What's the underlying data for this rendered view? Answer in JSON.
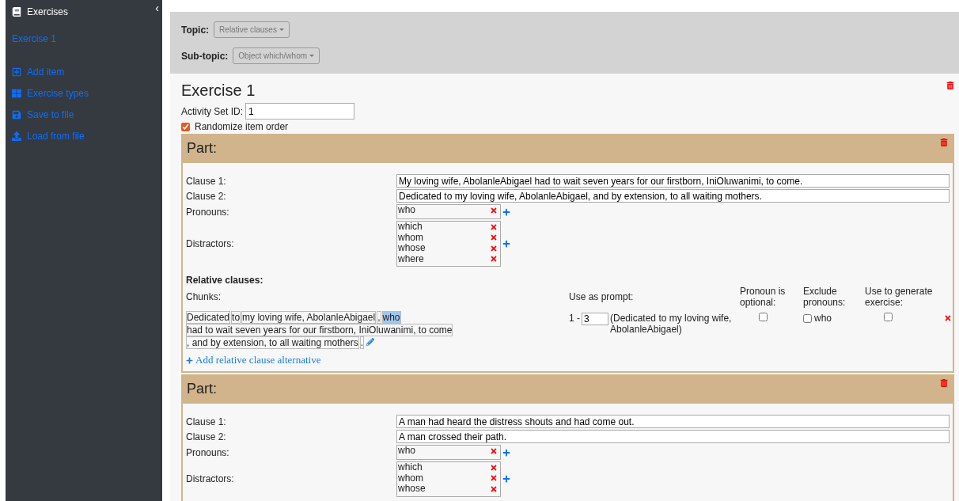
{
  "sidebar": {
    "collapse": "‹",
    "title": "Exercises",
    "exercises": [
      {
        "label": "Exercise 1"
      }
    ],
    "actions": [
      {
        "kind": "add",
        "label": "Add item"
      },
      {
        "kind": "types",
        "label": "Exercise types"
      },
      {
        "kind": "save",
        "label": "Save to file"
      },
      {
        "kind": "load",
        "label": "Load from file"
      }
    ]
  },
  "filters": [
    {
      "label": "Topic:",
      "value": "Relative clauses"
    },
    {
      "label": "Sub-topic:",
      "value": "Object which/whom"
    }
  ],
  "exercise": {
    "title": "Exercise 1",
    "activity_label": "Activity Set ID:",
    "activity_id": "1",
    "randomize_label": "Randomize item order",
    "randomize": true,
    "parts": [
      {
        "title": "Part:",
        "clause1_label": "Clause 1:",
        "clause1": "My loving wife, AbolanleAbigael had to wait seven years for our firstborn, IniOluwanimi, to come.",
        "clause2_label": "Clause 2:",
        "clause2": "Dedicated to my loving wife, AbolanleAbigael, and by extension, to all waiting mothers.",
        "pronouns_label": "Pronouns:",
        "pronouns": [
          "who"
        ],
        "distractors_label": "Distractors:",
        "distractors": [
          "which",
          "whom",
          "whose",
          "where"
        ],
        "relative": {
          "heading": "Relative clauses:",
          "chunks_label": "Chunks:",
          "prompt_label": "Use as prompt:",
          "optional_label": "Pronoun is optional:",
          "exclude_label": "Exclude pronouns:",
          "generate_label": "Use to generate exercise:",
          "rows": [
            {
              "chunks": [
                {
                  "text": "Dedicated",
                  "selected": false
                },
                {
                  "text": "to",
                  "selected": false
                },
                {
                  "text": "my loving wife, AbolanleAbigael",
                  "selected": false
                },
                {
                  "text": ",",
                  "selected": false
                },
                {
                  "text": "who",
                  "selected": true
                },
                {
                  "text": "had to wait seven years for our firstborn, IniOluwanimi, to come",
                  "selected": false
                },
                {
                  "text": ", and by extension, to all waiting mothers",
                  "selected": false
                },
                {
                  "text": ".",
                  "selected": false
                }
              ],
              "prompt_from": "1 -",
              "prompt_to": "3",
              "prompt_text": "(Dedicated to my loving wife, AbolanleAbigael)",
              "optional": false,
              "exclude": [
                {
                  "label": "who",
                  "checked": false
                }
              ],
              "generate": false
            }
          ],
          "add_label": "Add relative clause alternative"
        }
      },
      {
        "title": "Part:",
        "clause1_label": "Clause 1:",
        "clause1": "A man had heard the distress shouts and had come out.",
        "clause2_label": "Clause 2:",
        "clause2": "A man crossed their path.",
        "pronouns_label": "Pronouns:",
        "pronouns": [
          "who"
        ],
        "distractors_label": "Distractors:",
        "distractors": [
          "which",
          "whom",
          "whose"
        ]
      }
    ]
  }
}
